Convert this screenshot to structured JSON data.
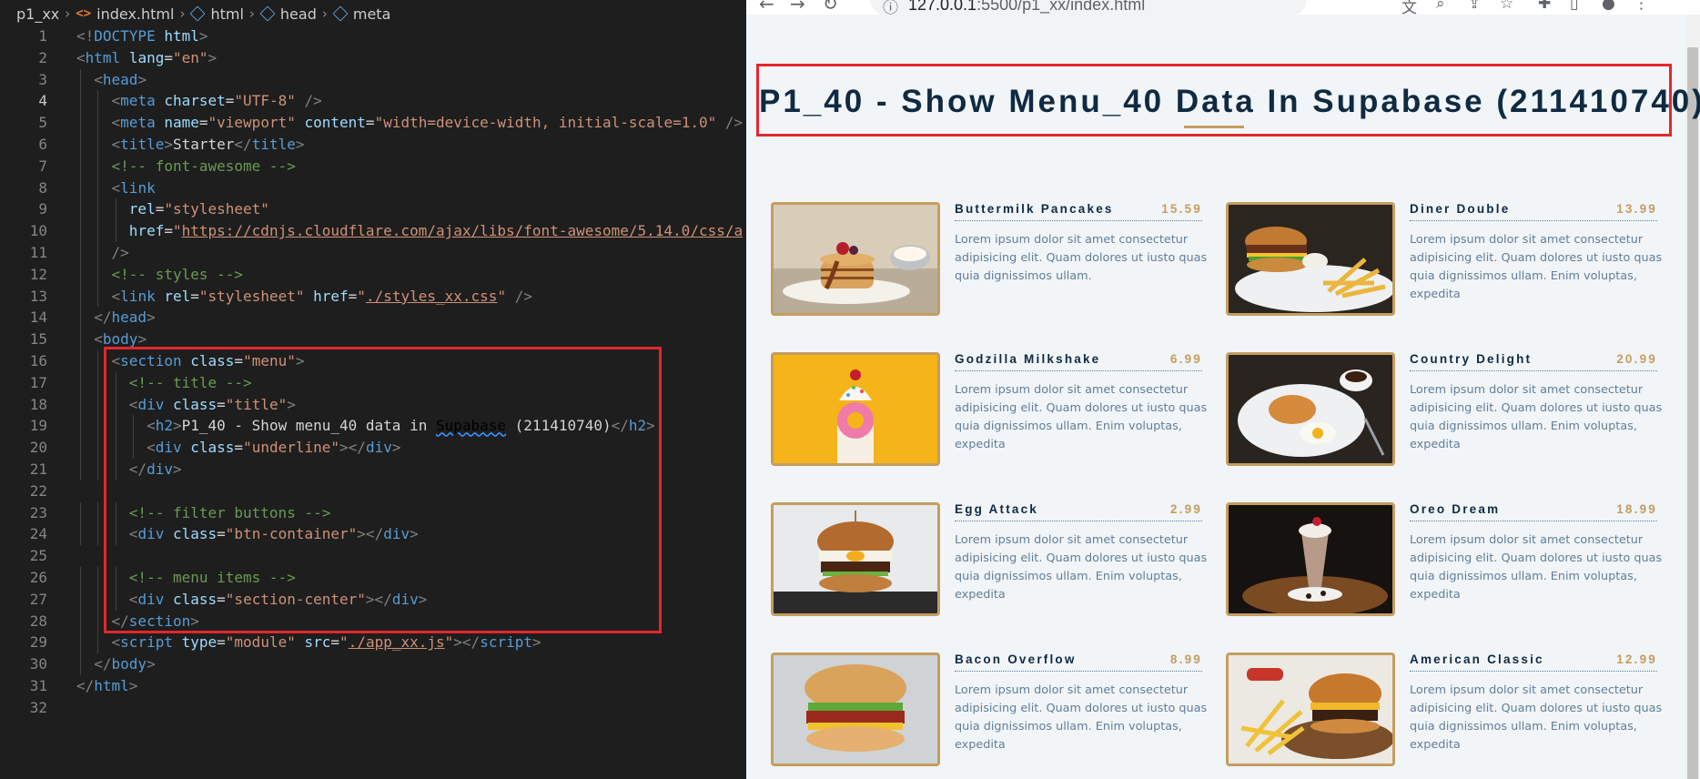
{
  "editor": {
    "breadcrumb": [
      "p1_xx",
      "index.html",
      "html",
      "head",
      "meta"
    ],
    "active_line": 4,
    "lines": [
      [
        [
          "p",
          "<!"
        ],
        [
          "tag",
          "DOCTYPE"
        ],
        [
          "txt",
          " "
        ],
        [
          "attr",
          "html"
        ],
        [
          "p",
          ">"
        ]
      ],
      [
        [
          "p",
          "<"
        ],
        [
          "tag",
          "html"
        ],
        [
          "txt",
          " "
        ],
        [
          "attr",
          "lang"
        ],
        [
          "txt",
          "="
        ],
        [
          "str",
          "\"en\""
        ],
        [
          "p",
          ">"
        ]
      ],
      [
        [
          "txt",
          "  "
        ],
        [
          "p",
          "<"
        ],
        [
          "tag",
          "head"
        ],
        [
          "p",
          ">"
        ]
      ],
      [
        [
          "txt",
          "    "
        ],
        [
          "p",
          "<"
        ],
        [
          "tag",
          "meta"
        ],
        [
          "txt",
          " "
        ],
        [
          "attr",
          "charset"
        ],
        [
          "txt",
          "="
        ],
        [
          "str",
          "\"UTF-8\""
        ],
        [
          "txt",
          " "
        ],
        [
          "p",
          "/>"
        ]
      ],
      [
        [
          "txt",
          "    "
        ],
        [
          "p",
          "<"
        ],
        [
          "tag",
          "meta"
        ],
        [
          "txt",
          " "
        ],
        [
          "attr",
          "name"
        ],
        [
          "txt",
          "="
        ],
        [
          "str",
          "\"viewport\""
        ],
        [
          "txt",
          " "
        ],
        [
          "attr",
          "content"
        ],
        [
          "txt",
          "="
        ],
        [
          "str",
          "\"width=device-width, initial-scale=1.0\""
        ],
        [
          "txt",
          " "
        ],
        [
          "p",
          "/>"
        ]
      ],
      [
        [
          "txt",
          "    "
        ],
        [
          "p",
          "<"
        ],
        [
          "tag",
          "title"
        ],
        [
          "p",
          ">"
        ],
        [
          "txt",
          "Starter"
        ],
        [
          "p",
          "</"
        ],
        [
          "tag",
          "title"
        ],
        [
          "p",
          ">"
        ]
      ],
      [
        [
          "txt",
          "    "
        ],
        [
          "com",
          "<!-- font-awesome -->"
        ]
      ],
      [
        [
          "txt",
          "    "
        ],
        [
          "p",
          "<"
        ],
        [
          "tag",
          "link"
        ]
      ],
      [
        [
          "txt",
          "      "
        ],
        [
          "attr",
          "rel"
        ],
        [
          "txt",
          "="
        ],
        [
          "str",
          "\"stylesheet\""
        ]
      ],
      [
        [
          "txt",
          "      "
        ],
        [
          "attr",
          "href"
        ],
        [
          "txt",
          "="
        ],
        [
          "str",
          "\""
        ],
        [
          "url",
          "https://cdnjs.cloudflare.com/ajax/libs/font-awesome/5.14.0/css/a"
        ]
      ],
      [
        [
          "txt",
          "    "
        ],
        [
          "p",
          "/>"
        ]
      ],
      [
        [
          "txt",
          "    "
        ],
        [
          "com",
          "<!-- styles -->"
        ]
      ],
      [
        [
          "txt",
          "    "
        ],
        [
          "p",
          "<"
        ],
        [
          "tag",
          "link"
        ],
        [
          "txt",
          " "
        ],
        [
          "attr",
          "rel"
        ],
        [
          "txt",
          "="
        ],
        [
          "str",
          "\"stylesheet\""
        ],
        [
          "txt",
          " "
        ],
        [
          "attr",
          "href"
        ],
        [
          "txt",
          "="
        ],
        [
          "str",
          "\""
        ],
        [
          "url",
          "./styles_xx.css"
        ],
        [
          "str",
          "\""
        ],
        [
          "txt",
          " "
        ],
        [
          "p",
          "/>"
        ]
      ],
      [
        [
          "txt",
          "  "
        ],
        [
          "p",
          "</"
        ],
        [
          "tag",
          "head"
        ],
        [
          "p",
          ">"
        ]
      ],
      [
        [
          "txt",
          "  "
        ],
        [
          "p",
          "<"
        ],
        [
          "tag",
          "body"
        ],
        [
          "p",
          ">"
        ]
      ],
      [
        [
          "txt",
          "    "
        ],
        [
          "p",
          "<"
        ],
        [
          "tag",
          "section"
        ],
        [
          "txt",
          " "
        ],
        [
          "attr",
          "class"
        ],
        [
          "txt",
          "="
        ],
        [
          "str",
          "\"menu\""
        ],
        [
          "p",
          ">"
        ]
      ],
      [
        [
          "txt",
          "      "
        ],
        [
          "com",
          "<!-- title -->"
        ]
      ],
      [
        [
          "txt",
          "      "
        ],
        [
          "p",
          "<"
        ],
        [
          "tag",
          "div"
        ],
        [
          "txt",
          " "
        ],
        [
          "attr",
          "class"
        ],
        [
          "txt",
          "="
        ],
        [
          "str",
          "\"title\""
        ],
        [
          "p",
          ">"
        ]
      ],
      [
        [
          "txt",
          "        "
        ],
        [
          "p",
          "<"
        ],
        [
          "tag",
          "h2"
        ],
        [
          "p",
          ">"
        ],
        [
          "txt",
          "P1_40 - Show menu_40 data in "
        ],
        [
          "squig",
          "Supabase"
        ],
        [
          "txt",
          " (211410740)"
        ],
        [
          "p",
          "</"
        ],
        [
          "tag",
          "h2"
        ],
        [
          "p",
          ">"
        ]
      ],
      [
        [
          "txt",
          "        "
        ],
        [
          "p",
          "<"
        ],
        [
          "tag",
          "div"
        ],
        [
          "txt",
          " "
        ],
        [
          "attr",
          "class"
        ],
        [
          "txt",
          "="
        ],
        [
          "str",
          "\"underline\""
        ],
        [
          "p",
          "></"
        ],
        [
          "tag",
          "div"
        ],
        [
          "p",
          ">"
        ]
      ],
      [
        [
          "txt",
          "      "
        ],
        [
          "p",
          "</"
        ],
        [
          "tag",
          "div"
        ],
        [
          "p",
          ">"
        ]
      ],
      [],
      [
        [
          "txt",
          "      "
        ],
        [
          "com",
          "<!-- filter buttons -->"
        ]
      ],
      [
        [
          "txt",
          "      "
        ],
        [
          "p",
          "<"
        ],
        [
          "tag",
          "div"
        ],
        [
          "txt",
          " "
        ],
        [
          "attr",
          "class"
        ],
        [
          "txt",
          "="
        ],
        [
          "str",
          "\"btn-container\""
        ],
        [
          "p",
          "></"
        ],
        [
          "tag",
          "div"
        ],
        [
          "p",
          ">"
        ]
      ],
      [],
      [
        [
          "txt",
          "      "
        ],
        [
          "com",
          "<!-- menu items -->"
        ]
      ],
      [
        [
          "txt",
          "      "
        ],
        [
          "p",
          "<"
        ],
        [
          "tag",
          "div"
        ],
        [
          "txt",
          " "
        ],
        [
          "attr",
          "class"
        ],
        [
          "txt",
          "="
        ],
        [
          "str",
          "\"section-center\""
        ],
        [
          "p",
          "></"
        ],
        [
          "tag",
          "div"
        ],
        [
          "p",
          ">"
        ]
      ],
      [
        [
          "txt",
          "    "
        ],
        [
          "p",
          "</"
        ],
        [
          "tag",
          "section"
        ],
        [
          "p",
          ">"
        ]
      ],
      [
        [
          "txt",
          "    "
        ],
        [
          "p",
          "<"
        ],
        [
          "tag",
          "script"
        ],
        [
          "txt",
          " "
        ],
        [
          "attr",
          "type"
        ],
        [
          "txt",
          "="
        ],
        [
          "str",
          "\"module\""
        ],
        [
          "txt",
          " "
        ],
        [
          "attr",
          "src"
        ],
        [
          "txt",
          "="
        ],
        [
          "str",
          "\""
        ],
        [
          "url",
          "./app_xx.js"
        ],
        [
          "str",
          "\""
        ],
        [
          "p",
          "></"
        ],
        [
          "tag",
          "script"
        ],
        [
          "p",
          ">"
        ]
      ],
      [
        [
          "txt",
          "  "
        ],
        [
          "p",
          "</"
        ],
        [
          "tag",
          "body"
        ],
        [
          "p",
          ">"
        ]
      ],
      [
        [
          "p",
          "</"
        ],
        [
          "tag",
          "html"
        ],
        [
          "p",
          ">"
        ]
      ],
      []
    ]
  },
  "browser": {
    "url_host": "127.0.0.1",
    "url_rest": ":5500/p1_xx/index.html",
    "icons": [
      "back-icon",
      "forward-icon",
      "reload-icon",
      "info-icon",
      "translate-icon",
      "zoom-icon",
      "share-icon",
      "star-icon",
      "extensions-icon",
      "sidepanel-icon",
      "profile-icon",
      "more-icon"
    ]
  },
  "page": {
    "title": "P1_40 - Show Menu_40 Data In Supabase (211410740)",
    "accent": "#c59d5f",
    "items": [
      {
        "name": "Buttermilk Pancakes",
        "price": "15.59",
        "desc": "Lorem ipsum dolor sit amet consectetur adipisicing elit. Quam dolores ut iusto quas quia dignissimos ullam.",
        "image": "pancakes"
      },
      {
        "name": "Diner Double",
        "price": "13.99",
        "desc": "Lorem ipsum dolor sit amet consectetur adipisicing elit. Quam dolores ut iusto quas quia dignissimos ullam. Enim voluptas, expedita",
        "image": "burger-fries"
      },
      {
        "name": "Godzilla Milkshake",
        "price": "6.99",
        "desc": "Lorem ipsum dolor sit amet consectetur adipisicing elit. Quam dolores ut iusto quas quia dignissimos ullam. Enim voluptas, expedita",
        "image": "milkshake-yellow"
      },
      {
        "name": "Country Delight",
        "price": "20.99",
        "desc": "Lorem ipsum dolor sit amet consectetur adipisicing elit. Quam dolores ut iusto quas quia dignissimos ullam. Enim voluptas, expedita",
        "image": "breakfast-plate"
      },
      {
        "name": "Egg Attack",
        "price": "2.99",
        "desc": "Lorem ipsum dolor sit amet consectetur adipisicing elit. Quam dolores ut iusto quas quia dignissimos ullam. Enim voluptas, expedita",
        "image": "egg-burger"
      },
      {
        "name": "Oreo Dream",
        "price": "18.99",
        "desc": "Lorem ipsum dolor sit amet consectetur adipisicing elit. Quam dolores ut iusto quas quia dignissimos ullam. Enim voluptas, expedita",
        "image": "oreo-shake"
      },
      {
        "name": "Bacon Overflow",
        "price": "8.99",
        "desc": "Lorem ipsum dolor sit amet consectetur adipisicing elit. Quam dolores ut iusto quas quia dignissimos ullam. Enim voluptas, expedita",
        "image": "bacon-sandwich"
      },
      {
        "name": "American Classic",
        "price": "12.99",
        "desc": "Lorem ipsum dolor sit amet consectetur adipisicing elit. Quam dolores ut iusto quas quia dignissimos ullam. Enim voluptas, expedita",
        "image": "classic-burger"
      }
    ]
  }
}
